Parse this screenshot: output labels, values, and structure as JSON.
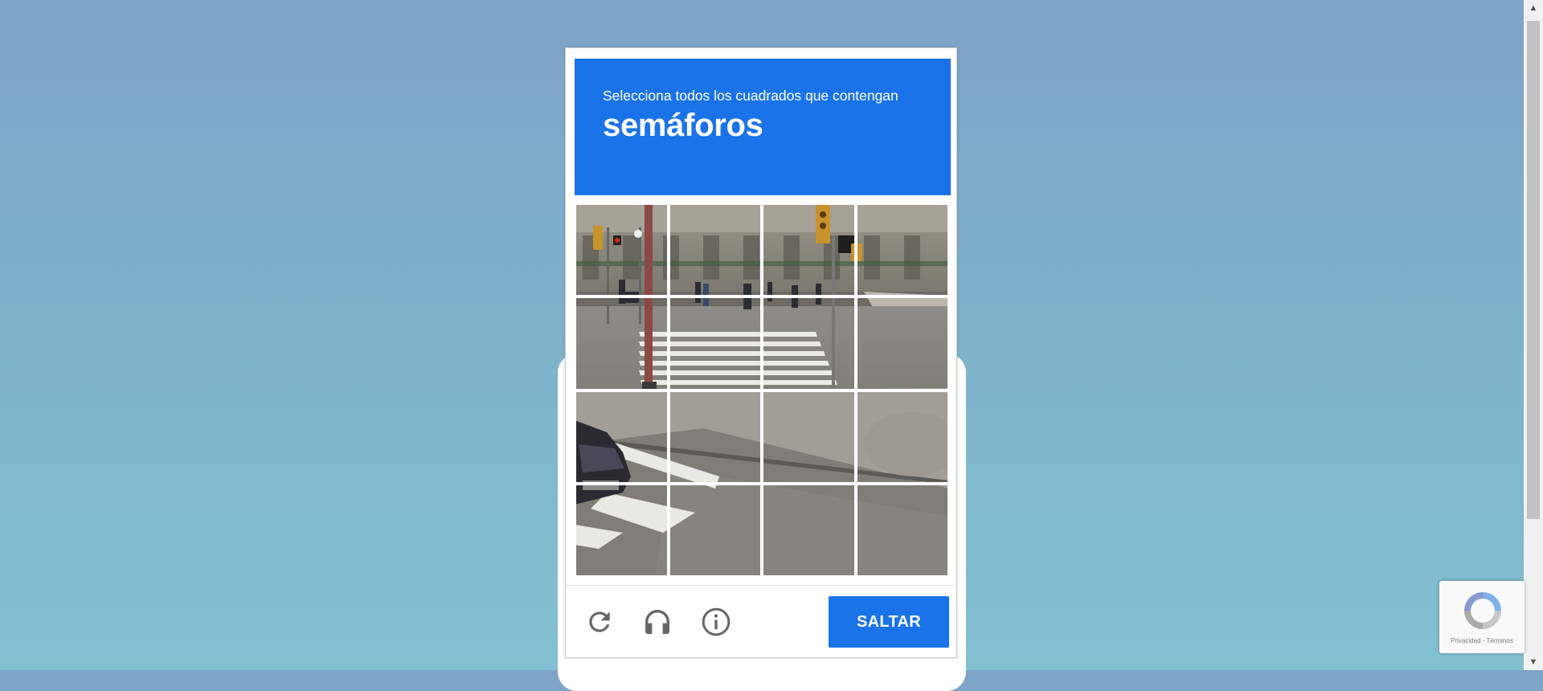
{
  "challenge": {
    "prompt": "Selecciona todos los cuadrados que contengan",
    "keyword": "semáforos",
    "grid": {
      "rows": 4,
      "cols": 4
    }
  },
  "footer": {
    "reload_icon": "reload-icon",
    "audio_icon": "headphones-icon",
    "info_icon": "info-icon",
    "skip_label": "SALTAR"
  },
  "badge": {
    "links": "Privacidad - Términos"
  },
  "colors": {
    "accent": "#1a73e8",
    "background_top": "#7ea3c8",
    "background_bottom": "#82c0d0"
  }
}
